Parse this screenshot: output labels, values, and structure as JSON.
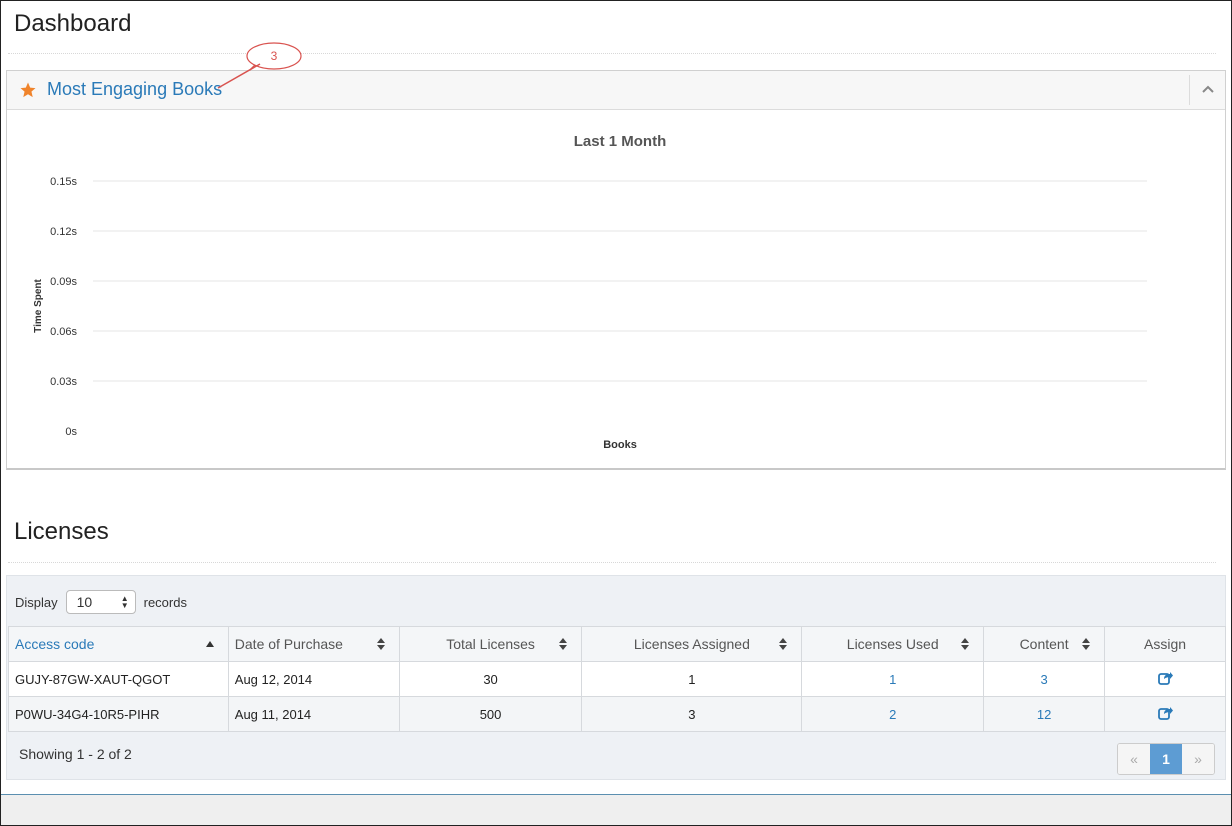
{
  "page": {
    "title": "Dashboard"
  },
  "engaging_panel": {
    "title": "Most Engaging Books",
    "callout_number": "3"
  },
  "chart_data": {
    "type": "bar",
    "title": "Last 1 Month",
    "xlabel": "Books",
    "ylabel": "Time Spent",
    "categories": [],
    "values": [],
    "y_ticks": [
      "0s",
      "0.03s",
      "0.06s",
      "0.09s",
      "0.12s",
      "0.15s"
    ],
    "ylim": [
      0,
      0.15
    ],
    "grid": true
  },
  "licenses": {
    "title": "Licenses",
    "display_label": "Display",
    "records_label": "records",
    "page_size": "10",
    "columns": [
      "Access code",
      "Date of Purchase",
      "Total Licenses",
      "Licenses Assigned",
      "Licenses Used",
      "Content",
      "Assign"
    ],
    "rows": [
      {
        "access_code": "GUJY-87GW-XAUT-QGOT",
        "date": "Aug 12, 2014",
        "total": "30",
        "assigned": "1",
        "used": "1",
        "content": "3"
      },
      {
        "access_code": "P0WU-34G4-10R5-PIHR",
        "date": "Aug 11, 2014",
        "total": "500",
        "assigned": "3",
        "used": "2",
        "content": "12"
      }
    ],
    "showing": "Showing 1 - 2 of 2",
    "pager": {
      "prev": "«",
      "current": "1",
      "next": "»"
    }
  },
  "colors": {
    "link": "#2a7ab8",
    "star": "#f0842c",
    "callout_border": "#d9534f",
    "pager_active": "#5d9cd3"
  }
}
